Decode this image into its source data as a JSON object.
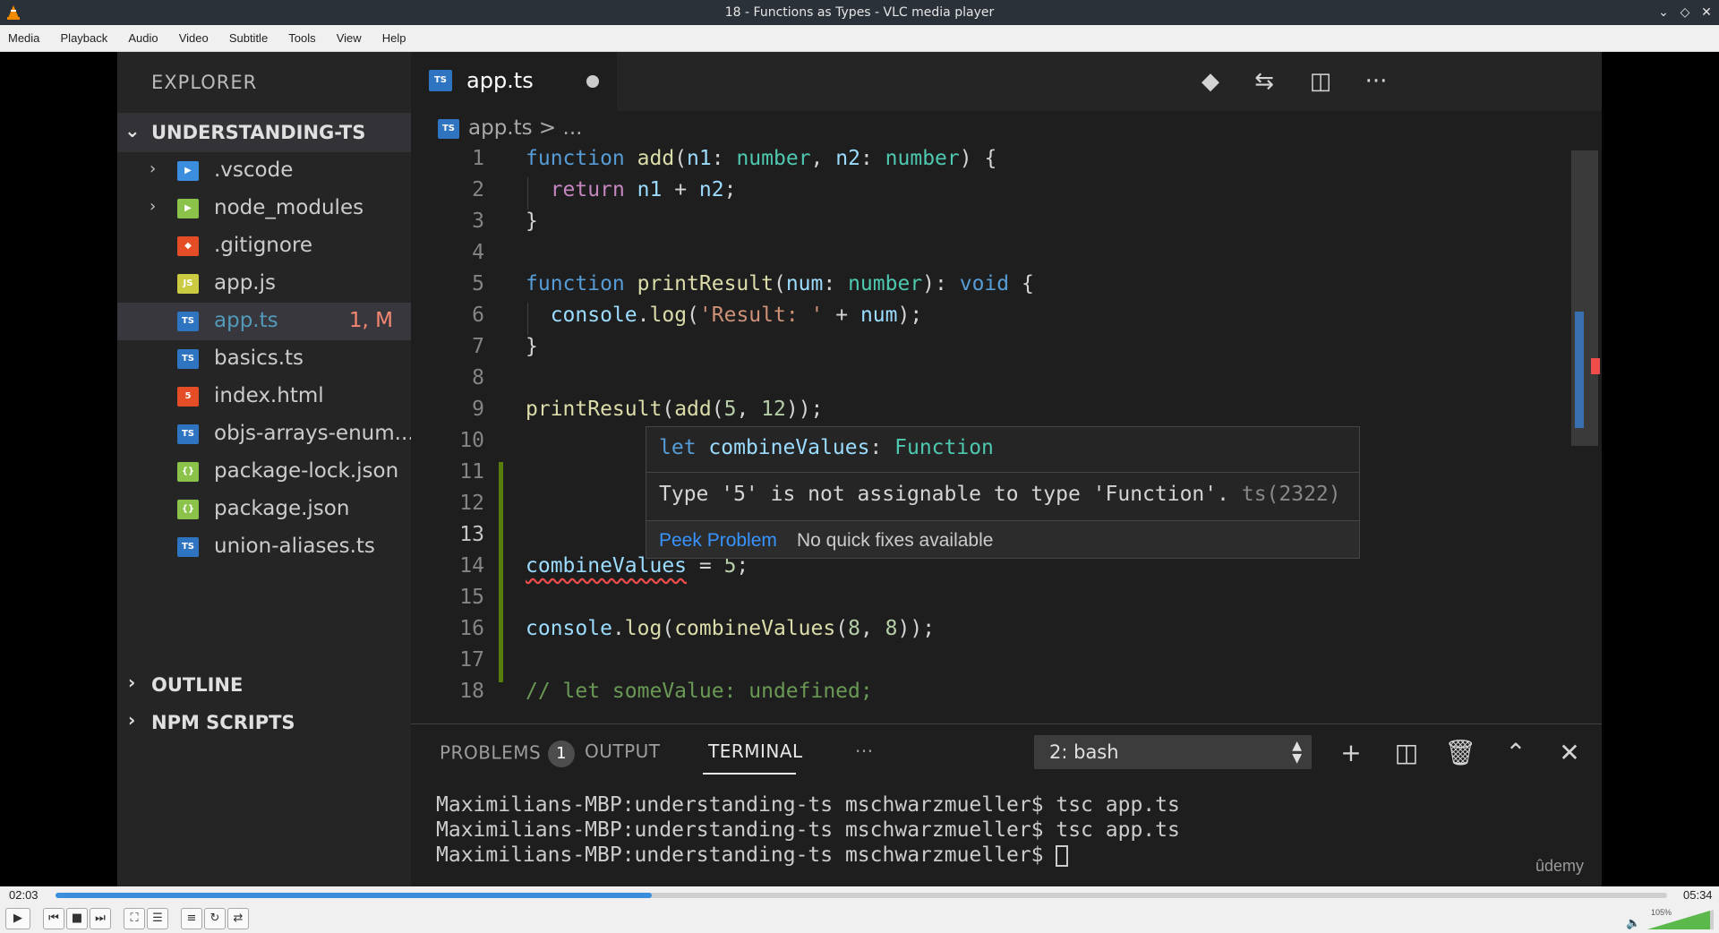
{
  "window": {
    "title": "18 - Functions as Types - VLC media player"
  },
  "menu": [
    "Media",
    "Playback",
    "Audio",
    "Video",
    "Subtitle",
    "Tools",
    "View",
    "Help"
  ],
  "explorer": {
    "title": "EXPLORER",
    "project": "UNDERSTANDING-TS",
    "files": [
      {
        "name": ".vscode",
        "type": "folder",
        "icon": "vscode-folder-icon",
        "color": "#3b8ede"
      },
      {
        "name": "node_modules",
        "type": "folder",
        "icon": "node-folder-icon",
        "color": "#8bc34a"
      },
      {
        "name": ".gitignore",
        "type": "file",
        "icon": "git-icon",
        "color": "#e44d26"
      },
      {
        "name": "app.js",
        "type": "file",
        "icon": "js-icon",
        "color": "#cbcb41"
      },
      {
        "name": "app.ts",
        "type": "file",
        "icon": "ts-icon",
        "color": "#2f74c0",
        "badge": "1, M",
        "active": true
      },
      {
        "name": "basics.ts",
        "type": "file",
        "icon": "ts-icon",
        "color": "#2f74c0"
      },
      {
        "name": "index.html",
        "type": "file",
        "icon": "html-icon",
        "color": "#e44d26"
      },
      {
        "name": "objs-arrays-enum...",
        "type": "file",
        "icon": "ts-icon",
        "color": "#2f74c0"
      },
      {
        "name": "package-lock.json",
        "type": "file",
        "icon": "json-icon",
        "color": "#8bc34a"
      },
      {
        "name": "package.json",
        "type": "file",
        "icon": "json-icon",
        "color": "#8bc34a"
      },
      {
        "name": "union-aliases.ts",
        "type": "file",
        "icon": "ts-icon",
        "color": "#2f74c0"
      }
    ],
    "outline": "OUTLINE",
    "npm_scripts": "NPM SCRIPTS"
  },
  "editor": {
    "tab_label": "app.ts",
    "breadcrumb_file": "app.ts",
    "breadcrumb_rest": "> ...",
    "line_numbers": [
      "1",
      "2",
      "3",
      "4",
      "5",
      "6",
      "7",
      "8",
      "9",
      "10",
      "11",
      "12",
      "13",
      "14",
      "15",
      "16",
      "17",
      "18"
    ],
    "current_line": "13"
  },
  "hover": {
    "signature_kw": "let",
    "signature_name": "combineValues",
    "signature_type": "Function",
    "message": "Type '5' is not assignable to type 'Function'.",
    "error_code": "ts(2322)",
    "peek": "Peek Problem",
    "nofix": "No quick fixes available"
  },
  "panel": {
    "problems": "PROBLEMS",
    "problems_count": "1",
    "output": "OUTPUT",
    "terminal": "TERMINAL",
    "more": "···",
    "shell": "2: bash",
    "lines": [
      "Maximilians-MBP:understanding-ts mschwarzmueller$ tsc app.ts",
      "Maximilians-MBP:understanding-ts mschwarzmueller$ tsc app.ts",
      "Maximilians-MBP:understanding-ts mschwarzmueller$ "
    ],
    "watermark": "ûdemy"
  },
  "player": {
    "elapsed": "02:03",
    "total": "05:34",
    "progress": 0.37,
    "volume": "105%"
  }
}
